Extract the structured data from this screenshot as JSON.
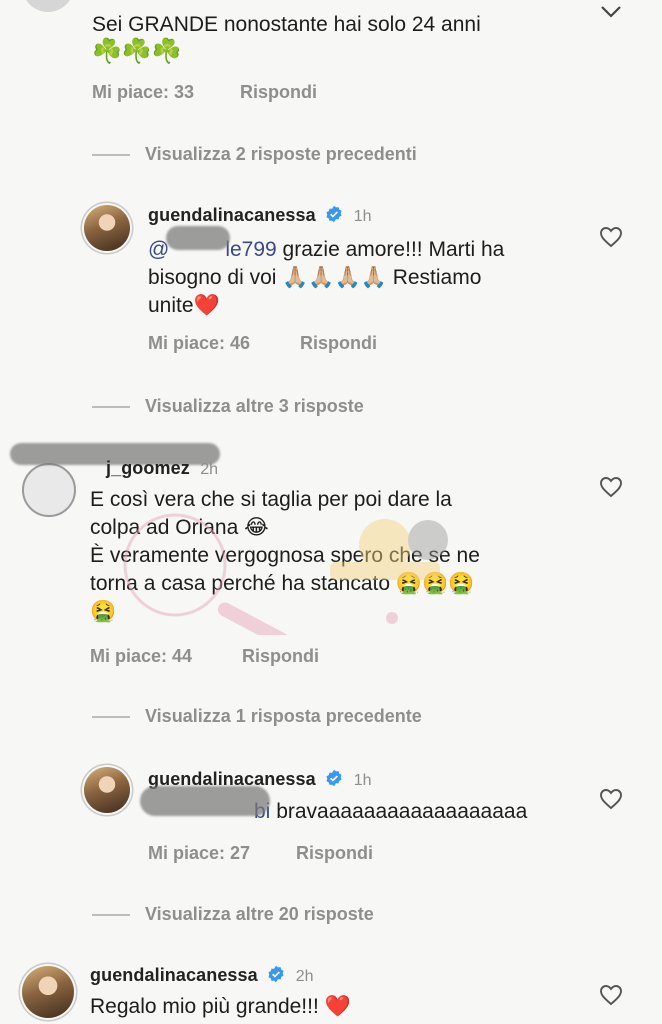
{
  "comments": [
    {
      "text": "Sei GRANDE nonostante hai solo 24 anni",
      "emojis": "☘️☘️☘️",
      "likes": "Mi piace: 33",
      "reply": "Rispondi"
    },
    {
      "view_previous": "Visualizza 2 risposte precedenti"
    },
    {
      "username": "guendalinacanessa",
      "time": "1h",
      "mention": "@",
      "mention_tail": "le799",
      "text_line1": " grazie amore!!! Marti ha",
      "text_line2_a": "bisogno di voi ",
      "hands": "🙏🏼🙏🏼🙏🏼🙏🏼",
      "text_line2_b": " Restiamo",
      "text_line3": "unite",
      "heart_emoji": "❤️",
      "likes": "Mi piace: 46",
      "reply": "Rispondi"
    },
    {
      "view_more": "Visualizza altre 3 risposte"
    },
    {
      "username_tail": "j_goomez",
      "time": "2h",
      "line1": "E così vera che si taglia per poi dare la",
      "line2": "colpa ad Oriana ",
      "laugh": "😂",
      "line3": "È veramente vergognosa spero che se ne",
      "line4": "torna a casa perché ha stancato ",
      "sick": "🤮🤮🤮",
      "sick2": "🤮",
      "likes": "Mi piace: 44",
      "reply": "Rispondi"
    },
    {
      "view_previous": "Visualizza 1 risposta precedente"
    },
    {
      "username": "guendalinacanessa",
      "time": "1h",
      "mention_tail": "bi",
      "text": " bravaaaaaaaaaaaaaaaaaa",
      "likes": "Mi piace: 27",
      "reply": "Rispondi"
    },
    {
      "view_more": "Visualizza altre 20 risposte"
    },
    {
      "username": "guendalinacanessa",
      "time": "2h",
      "text": "Regalo mio più grande!!! ",
      "heart_emoji": "❤️"
    }
  ],
  "icons": [
    "heart-outline-icon",
    "verified-badge-icon",
    "chevron-down-icon"
  ],
  "colors": {
    "accent": "#3b4a86",
    "verified": "#3897f0",
    "muted": "#8e8e8e"
  }
}
